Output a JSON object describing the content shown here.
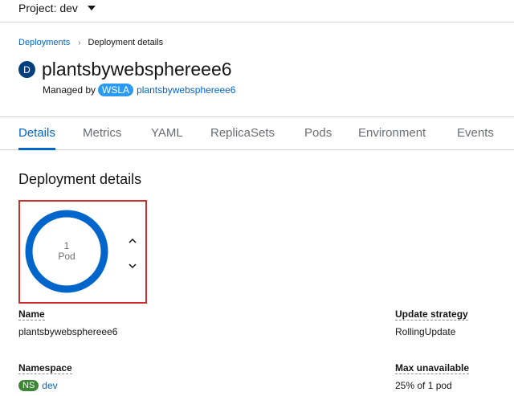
{
  "project": {
    "label": "Project: dev"
  },
  "breadcrumb": {
    "parent": "Deployments",
    "current": "Deployment details"
  },
  "resource": {
    "badge": "D",
    "name": "plantsbywebsphereee6"
  },
  "managed_by": {
    "label": "Managed by",
    "badge": "WSLA",
    "name": "plantsbywebsphereee6"
  },
  "tabs": [
    {
      "label": "Details",
      "active": true
    },
    {
      "label": "Metrics"
    },
    {
      "label": "YAML"
    },
    {
      "label": "ReplicaSets"
    },
    {
      "label": "Pods"
    },
    {
      "label": "Environment"
    },
    {
      "label": "Events"
    }
  ],
  "section": {
    "title": "Deployment details"
  },
  "pods": {
    "count": "1",
    "unit": "Pod",
    "ring_color": "#0066cc"
  },
  "details": {
    "name_label": "Name",
    "name_value": "plantsbywebsphereee6",
    "update_strategy_label": "Update strategy",
    "update_strategy_value": "RollingUpdate",
    "namespace_label": "Namespace",
    "namespace_badge": "NS",
    "namespace_value": "dev",
    "max_unavailable_label": "Max unavailable",
    "max_unavailable_value": "25% of 1 pod"
  },
  "colors": {
    "link": "#0066cc",
    "resource_badge": "#004080",
    "app_badge": "#2b9af3",
    "ns_badge": "#3e8635",
    "highlight": "#c9302c"
  }
}
